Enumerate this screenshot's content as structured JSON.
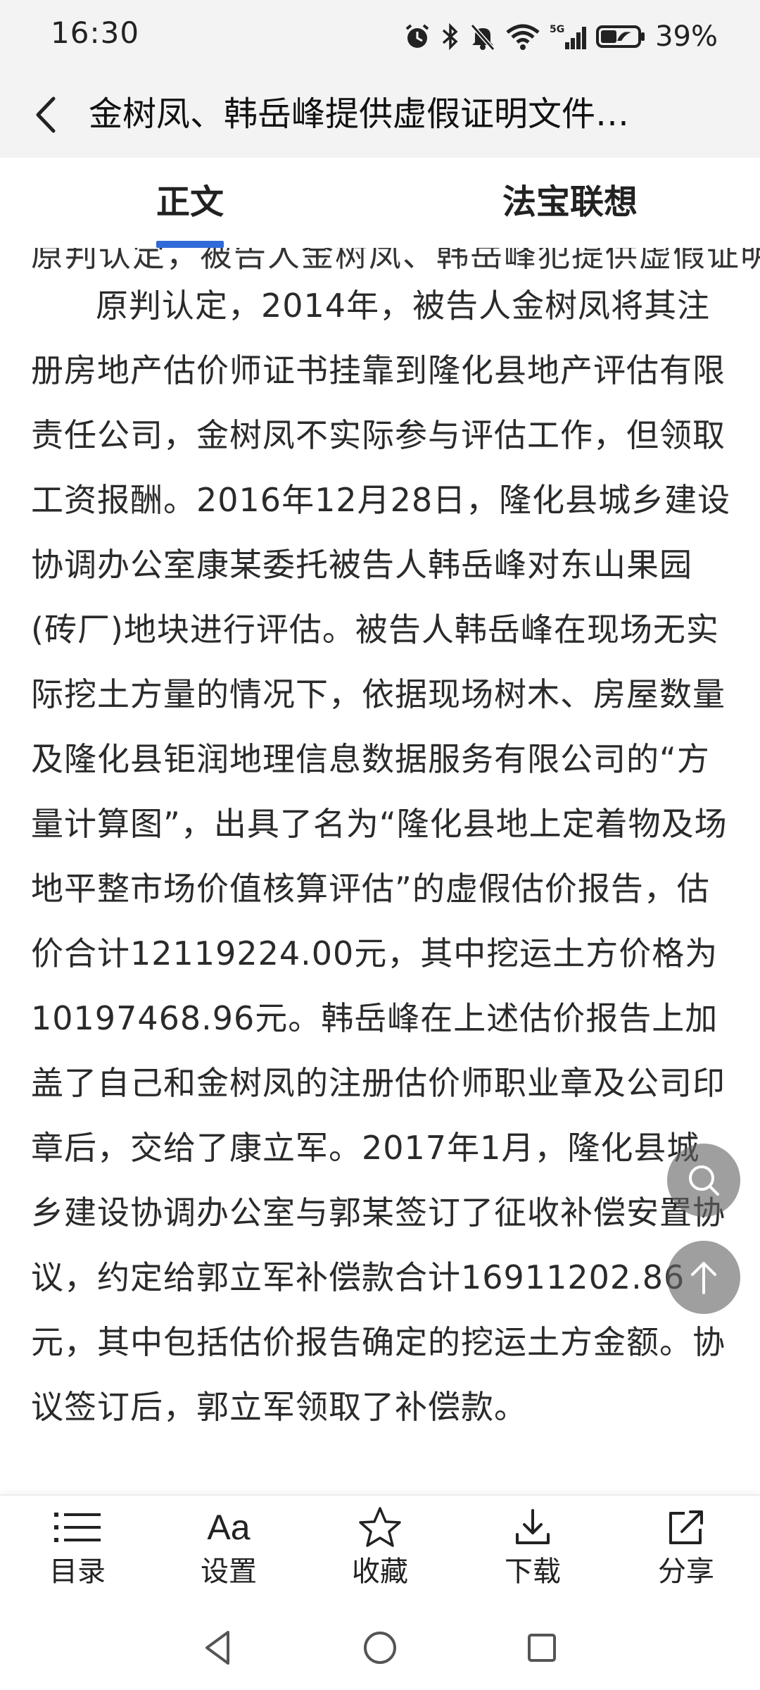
{
  "status": {
    "time": "16:30",
    "battery": "39%",
    "icons": [
      "alarm-icon",
      "bluetooth-icon",
      "mute-icon",
      "wifi-icon",
      "5g-signal-icon",
      "battery-icon"
    ]
  },
  "header": {
    "title": "金树凤、韩岳峰提供虚假证明文件…"
  },
  "tabs": [
    {
      "label": "正文",
      "active": true
    },
    {
      "label": "法宝联想",
      "active": false
    }
  ],
  "article": {
    "cut_line": "原判认定，被告人金树凤、韩岳峰犯提供虚假证明文件罪",
    "paragraph": "原判认定，2014年，被告人金树凤将其注册房地产估价师证书挂靠到隆化县地产评估有限责任公司，金树凤不实际参与评估工作，但领取工资报酬。2016年12月28日，隆化县城乡建设协调办公室康某委托被告人韩岳峰对东山果园(砖厂)地块进行评估。被告人韩岳峰在现场无实际挖土方量的情况下，依据现场树木、房屋数量及隆化县钜润地理信息数据服务有限公司的“方量计算图”，出具了名为“隆化县地上定着物及场地平整市场价值核算评估”的虚假估价报告，估价合计12119224.00元，其中挖运土方价格为10197468.96元。韩岳峰在上述估价报告上加盖了自己和金树凤的注册估价师职业章及公司印章后，交给了康立军。2017年1月，隆化县城乡建设协调办公室与郭某签订了征收补偿安置协议，约定给郭立军补偿款合计16911202.86元，其中包括估价报告确定的挖运土方金额。协议签订后，郭立军领取了补偿款。"
  },
  "toolbar": {
    "toc_label": "目录",
    "settings_label": "设置",
    "settings_glyph": "Aa",
    "favorite_label": "收藏",
    "download_label": "下载",
    "share_label": "分享"
  },
  "colors": {
    "accent": "#2f6ad8",
    "header_bg": "#f3f3f3",
    "fab_bg": "#6a6a6a"
  }
}
